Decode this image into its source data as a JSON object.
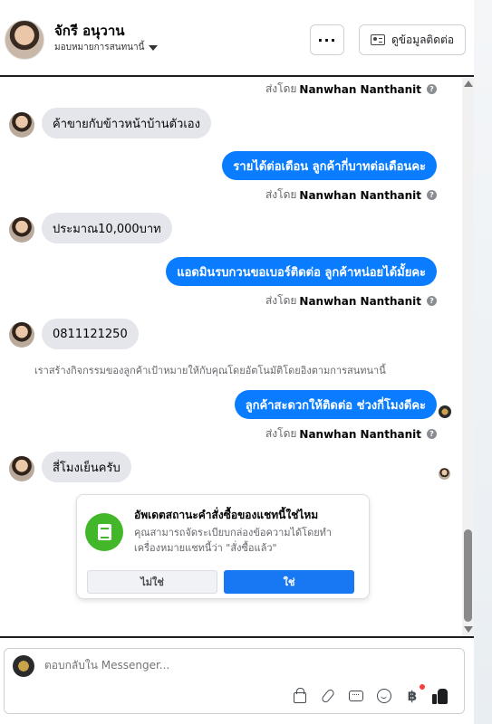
{
  "header": {
    "contact_name": "จักรี อนุวาน",
    "subtitle": "มอบหมายการสนทนานี้",
    "more_label": "···",
    "contact_info_label": "ดูข้อมูลติดต่อ"
  },
  "messages": {
    "sent_by_prefix": "ส่งโดย",
    "sender_name": "Nanwhan Nanthanit",
    "help_glyph": "?",
    "in_1": "ค้าขายกับข้าวหน้าบ้านตัวเอง",
    "out_1": "รายได้ต่อเดือน ลูกค้ากี่บาทต่อเดือนคะ",
    "in_2": "ประมาณ10,000บาท",
    "out_2": "แอดมินรบกวนขอเบอร์ติดต่อ ลูกค้าหน่อยได้มั้ยคะ",
    "in_3": "0811121250",
    "system_note": "เราสร้างกิจกรรมของลูกค้าเป้าหมายให้กับคุณโดยอัตโนมัติโดยอิงตามการสนทนานี้",
    "out_3": "ลูกค้าสะดวกให้ติดต่อ ช่วงกี่โมงดีคะ",
    "in_4": "สี่โมงเย็นครับ"
  },
  "order_card": {
    "title": "อัพเดตสถานะคำสั่งซื้อของแชทนี้ใช่ไหม",
    "body": "คุณสามารถจัดระเบียบกล่องข้อความได้โดยทำเครื่องหมายแชทนี้ว่า \"สั่งซื้อแล้ว\"",
    "no_label": "ไม่ใช่",
    "yes_label": "ใช่"
  },
  "composer": {
    "placeholder": "ตอบกลับใน Messenger...",
    "tools": [
      "shopping-bag-icon",
      "paperclip-icon",
      "saved-reply-icon",
      "emoji-icon",
      "baht-icon",
      "thumbs-up-icon"
    ],
    "baht_symbol": "฿"
  },
  "colors": {
    "outgoing_bubble": "#0a7cff",
    "incoming_bubble": "#e4e6eb",
    "order_icon": "#42b72a",
    "confirm_button": "#1877f2"
  }
}
